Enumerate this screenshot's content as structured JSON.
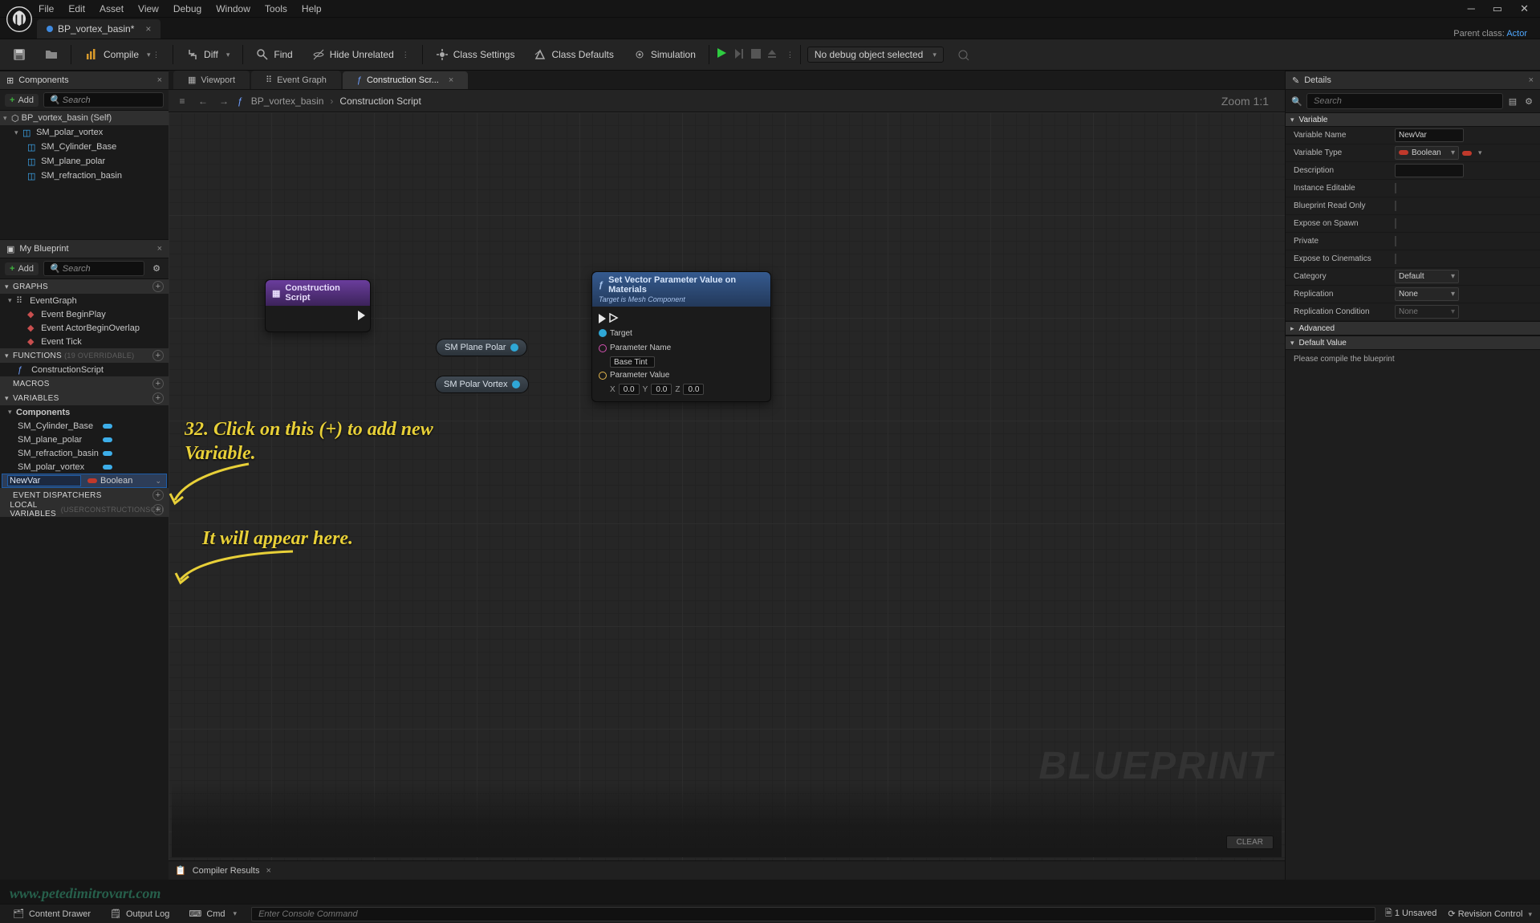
{
  "menu": {
    "file": "File",
    "edit": "Edit",
    "asset": "Asset",
    "view": "View",
    "debug": "Debug",
    "window": "Window",
    "tools": "Tools",
    "help": "Help"
  },
  "file_tab": {
    "name": "BP_vortex_basin*",
    "parent_label": "Parent class:",
    "parent_class": "Actor"
  },
  "toolbar": {
    "compile": "Compile",
    "diff": "Diff",
    "find": "Find",
    "hide_unrelated": "Hide Unrelated",
    "class_settings": "Class Settings",
    "class_defaults": "Class Defaults",
    "simulation": "Simulation",
    "debug_selector": "No debug object selected"
  },
  "components": {
    "title": "Components",
    "add": "Add",
    "search_ph": "Search",
    "tree": [
      {
        "label": "BP_vortex_basin (Self)",
        "indent": 0,
        "root": true
      },
      {
        "label": "SM_polar_vortex",
        "indent": 1
      },
      {
        "label": "SM_Cylinder_Base",
        "indent": 2
      },
      {
        "label": "SM_plane_polar",
        "indent": 2
      },
      {
        "label": "SM_refraction_basin",
        "indent": 2
      }
    ]
  },
  "myblueprint": {
    "title": "My Blueprint",
    "add": "Add",
    "search_ph": "Search",
    "graphs_hdr": "GRAPHS",
    "eventgraph": "EventGraph",
    "events": [
      "Event BeginPlay",
      "Event ActorBeginOverlap",
      "Event Tick"
    ],
    "functions_hdr": "FUNCTIONS",
    "functions_dim": "(19 OVERRIDABLE)",
    "construction_fn": "ConstructionScript",
    "macros_hdr": "MACROS",
    "variables_hdr": "VARIABLES",
    "vars_group": "Components",
    "vars": [
      "SM_Cylinder_Base",
      "SM_plane_polar",
      "SM_refraction_basin",
      "SM_polar_vortex"
    ],
    "newvar_name": "NewVar",
    "newvar_type": "Boolean",
    "dispatchers_hdr": "EVENT DISPATCHERS",
    "localvars_hdr": "LOCAL VARIABLES",
    "localvars_dim": "(USERCONSTRUCTIONSCRI"
  },
  "center_tabs": {
    "viewport": "Viewport",
    "eventgraph": "Event Graph",
    "construction": "Construction Scr..."
  },
  "graph_bar": {
    "bc1": "BP_vortex_basin",
    "bc2": "Construction Script",
    "zoom": "Zoom 1:1"
  },
  "nodes": {
    "construction": "Construction Script",
    "sm_plane": "SM Plane Polar",
    "sm_vortex": "SM Polar Vortex",
    "setvec_title": "Set Vector Parameter Value on Materials",
    "setvec_sub": "Target is Mesh Component",
    "target_lbl": "Target",
    "pname_lbl": "Parameter Name",
    "pname_val": "Base Tint",
    "pval_lbl": "Parameter Value",
    "x": "0.0",
    "y": "0.0",
    "z": "0.0",
    "xl": "X",
    "yl": "Y",
    "zl": "Z"
  },
  "watermark_bp": "BLUEPRINT",
  "clear_btn": "CLEAR",
  "compiler_results": "Compiler Results",
  "details": {
    "title": "Details",
    "search_ph": "Search",
    "variable_hdr": "Variable",
    "rows": {
      "name_lbl": "Variable Name",
      "name_val": "NewVar",
      "type_lbl": "Variable Type",
      "type_val": "Boolean",
      "desc_lbl": "Description",
      "inst_lbl": "Instance Editable",
      "ro_lbl": "Blueprint Read Only",
      "spawn_lbl": "Expose on Spawn",
      "priv_lbl": "Private",
      "cine_lbl": "Expose to Cinematics",
      "cat_lbl": "Category",
      "cat_val": "Default",
      "rep_lbl": "Replication",
      "rep_val": "None",
      "repc_lbl": "Replication Condition",
      "repc_val": "None"
    },
    "advanced_hdr": "Advanced",
    "default_hdr": "Default Value",
    "compile_msg": "Please compile the blueprint"
  },
  "statusbar": {
    "content_drawer": "Content Drawer",
    "output_log": "Output Log",
    "cmd": "Cmd",
    "console_ph": "Enter Console Command",
    "unsaved": "1 Unsaved",
    "revision": "Revision Control"
  },
  "annotation1": "32. Click on this (+) to add new Variable.",
  "annotation2": "It will appear here.",
  "site_watermark": "www.petedimitrovart.com"
}
